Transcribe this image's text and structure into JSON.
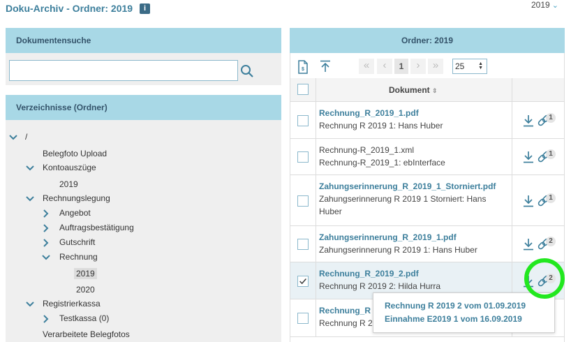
{
  "header": {
    "title": "Doku-Archiv - Ordner: 2019",
    "info_icon": "info-icon",
    "year_value": "2019"
  },
  "search": {
    "heading": "Dokumentensuche",
    "value": "",
    "placeholder": ""
  },
  "tree": {
    "heading": "Verzeichnisse (Ordner)",
    "root": "/",
    "items": [
      "Belegfoto Upload",
      "Kontoauszüge",
      "2019",
      "Rechnungslegung",
      "Angebot",
      "Auftragsbestätigung",
      "Gutschrift",
      "Rechnung",
      "2019",
      "2020",
      "Registrierkassa",
      "Testkassa (0)",
      "Verarbeitete Belegfotos"
    ],
    "selected": "2019"
  },
  "folder": {
    "heading": "Ordner: 2019",
    "page": "1",
    "page_size": "25",
    "column_header": "Dokument",
    "rows": [
      {
        "title": "Rechnung_R_2019_1.pdf",
        "desc": "Rechnung R 2019 1: Hans Huber",
        "links": "1",
        "checked": false,
        "title_link": true
      },
      {
        "title": "Rechnung-R_2019_1.xml",
        "desc": "Rechnung-R_2019_1: ebInterface",
        "links": "1",
        "checked": false,
        "title_link": false
      },
      {
        "title": "Zahungserinnerung_R_2019_1_Storniert.pdf",
        "desc": "Zahungserinnerung R 2019 1 Storniert: Hans Huber",
        "links": "1",
        "checked": false,
        "title_link": true
      },
      {
        "title": "Zahungserinnerung_R_2019_1.pdf",
        "desc": "Zahungserinnerung R 2019 1: Hans Huber",
        "links": "2",
        "checked": false,
        "title_link": true
      },
      {
        "title": "Rechnung_R_2019_2.pdf",
        "desc": "Rechnung R 2019 2: Hilda Hurra",
        "links": "2",
        "checked": true,
        "title_link": true
      },
      {
        "title": "Rechnung_R",
        "desc": "Rechnung R 2",
        "links": "",
        "checked": false,
        "title_link": true
      }
    ]
  },
  "tooltip": {
    "links": [
      "Rechnung R 2019 2 vom 01.09.2019",
      "Einnahme E2019 1 vom 16.09.2019"
    ]
  },
  "colors": {
    "accent": "#3d7f9c",
    "panel_header": "#a8d8e6",
    "highlight": "#22e81f"
  }
}
